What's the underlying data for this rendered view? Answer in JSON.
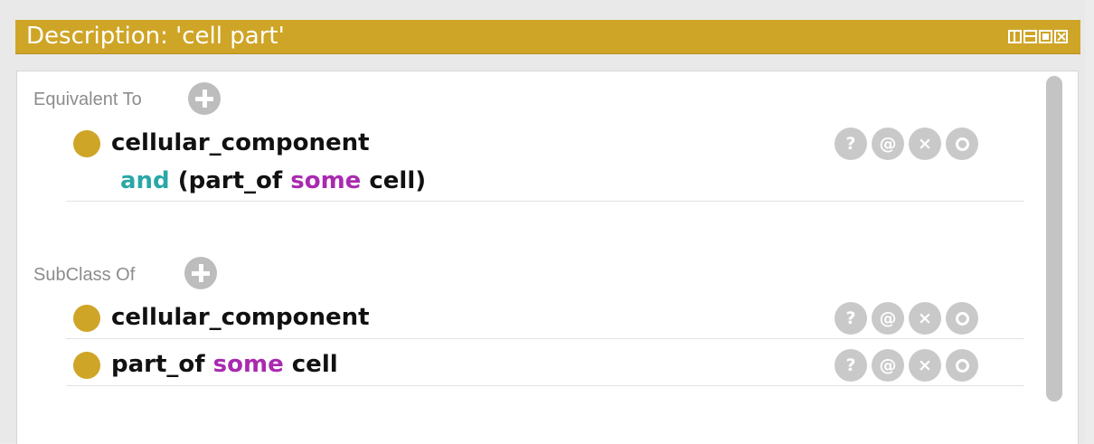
{
  "window": {
    "title": "Description: 'cell part'",
    "buttons": [
      "split-vertical",
      "split-horizontal",
      "maximize",
      "close"
    ]
  },
  "sections": {
    "equivalent_to": {
      "label": "Equivalent To",
      "items": [
        {
          "line1": "cellular_component",
          "line2_kw": "and",
          "line2_a": " (part_of ",
          "line2_kw2": "some",
          "line2_b": " cell)"
        }
      ]
    },
    "subclass_of": {
      "label": "SubClass Of",
      "items": [
        {
          "text": "cellular_component"
        },
        {
          "a": "part_of ",
          "kw": "some",
          "b": " cell"
        }
      ]
    }
  },
  "actions": {
    "help": "?",
    "annotate": "@",
    "delete": "×"
  },
  "colors": {
    "title_bar": "#cfa527",
    "bullet": "#cfa527",
    "keyword_and": "#2aa7a7",
    "keyword_some": "#a92ab0",
    "action_button": "#c9c9c9"
  }
}
